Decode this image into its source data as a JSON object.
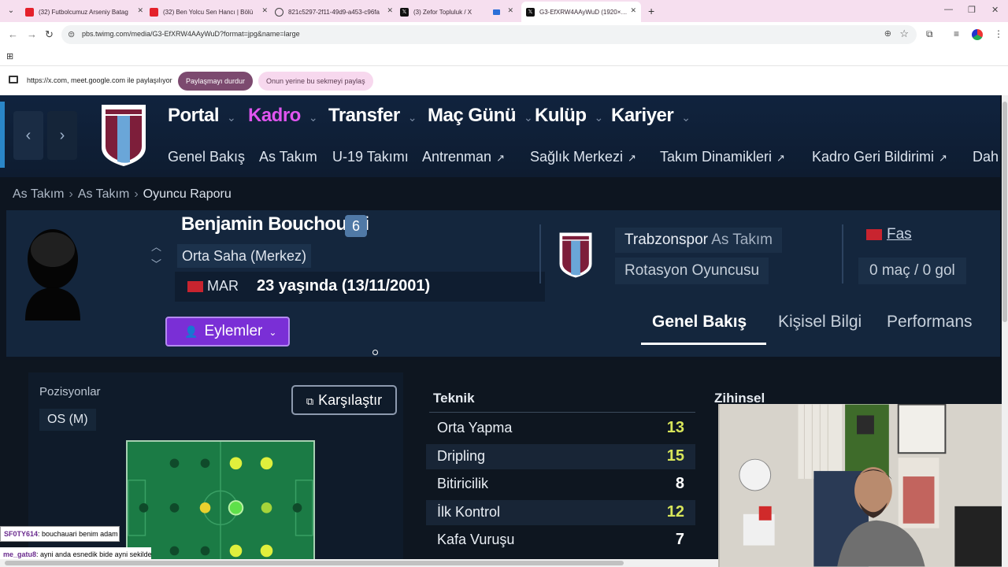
{
  "browser": {
    "tabs": [
      {
        "title": "(32) Futbolcumuz Arseniy Batag",
        "icon": "youtube-icon"
      },
      {
        "title": "(32) Ben Yolcu Sen Hancı | Bölü",
        "icon": "youtube-icon"
      },
      {
        "title": "821c5297-2f11-49d9-a453-c96fa",
        "icon": "globe-icon"
      },
      {
        "title": "(3) Zefor Topluluk / X",
        "icon": "x-icon"
      },
      {
        "title": "",
        "icon": "meet-icon"
      },
      {
        "title": "G3-EfXRW4AAyWuD (1920×1080)",
        "icon": "x-icon"
      }
    ],
    "url": "pbs.twimg.com/media/G3-EfXRW4AAyWuD?format=jpg&name=large",
    "share_text": "https://x.com, meet.google.com ile paylaşılıyor",
    "stop_sharing": "Paylaşmayı durdur",
    "share_this_tab": "Onun yerine bu sekmeyi paylaş"
  },
  "game": {
    "main_menu": [
      "Portal",
      "Kadro",
      "Transfer",
      "Maç Günü",
      "Kulüp",
      "Kariyer"
    ],
    "active_menu": "Kadro",
    "sub_menu": [
      {
        "label": "Genel Bakış",
        "ext": false
      },
      {
        "label": "As Takım",
        "ext": false
      },
      {
        "label": "U-19 Takımı",
        "ext": false
      },
      {
        "label": "Antrenman",
        "ext": true
      },
      {
        "label": "Sağlık Merkezi",
        "ext": true
      },
      {
        "label": "Takım Dinamikleri",
        "ext": true
      },
      {
        "label": "Kadro Geri Bildirimi",
        "ext": true
      },
      {
        "label": "Dah",
        "ext": false
      }
    ],
    "breadcrumb": [
      "As Takım",
      "As Takım",
      "Oyuncu Raporu"
    ],
    "player": {
      "name": "Benjamin Bouchouari",
      "number": "6",
      "position": "Orta Saha (Merkez)",
      "nationality_code": "MAR",
      "age": "23 yaşında (13/11/2001)",
      "club": "Trabzonspor",
      "team": "As Takım",
      "role": "Rotasyon Oyuncusu",
      "national_team": "Fas",
      "international_stats": "0 maç / 0 gol"
    },
    "actions_label": "Eylemler",
    "tabs": [
      "Genel Bakış",
      "Kişisel Bilgi",
      "Performans"
    ],
    "positions_title": "Pozisyonlar",
    "position_value": "OS (M)",
    "compare_label": "Karşılaştır",
    "technical_title": "Teknik",
    "mental_title": "Zihinsel",
    "technical_attributes": [
      {
        "name": "Orta Yapma",
        "value": "13",
        "color": "#d8e65a"
      },
      {
        "name": "Dripling",
        "value": "15",
        "color": "#d8e65a"
      },
      {
        "name": "Bitiricilik",
        "value": "8",
        "color": "#ffffff"
      },
      {
        "name": "İlk Kontrol",
        "value": "12",
        "color": "#d8e65a"
      },
      {
        "name": "Kafa Vuruşu",
        "value": "7",
        "color": "#ffffff"
      }
    ]
  },
  "chat": [
    {
      "user": "SF0TY614",
      "text": ": bouchauari benim adam"
    },
    {
      "user": "me_gatu8",
      "text": ": ayni anda esnedik bide ayni sekilde"
    }
  ],
  "colors": {
    "accent_purple": "#7a2fd6",
    "active_menu": "#e155f0",
    "attribute_high": "#d8e65a"
  }
}
